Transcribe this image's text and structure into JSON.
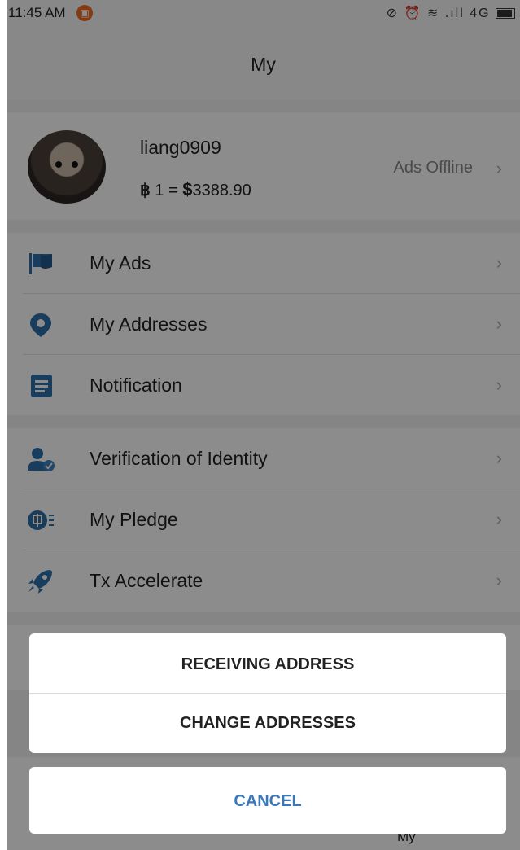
{
  "status_bar": {
    "time": "11:45 AM",
    "network": "4G",
    "signal_icons": "⊘ ⏰ ≋ .ıll"
  },
  "header": {
    "title": "My"
  },
  "profile": {
    "username": "liang0909",
    "rate_currency": "฿",
    "rate_prefix": "1 =",
    "rate_dollar": "$",
    "rate_value": "3388.90",
    "ads_status": "Ads Offline"
  },
  "menu_group_1": [
    {
      "label": "My Ads",
      "icon": "flag-icon"
    },
    {
      "label": "My Addresses",
      "icon": "location-pin-icon"
    },
    {
      "label": "Notification",
      "icon": "document-icon"
    }
  ],
  "menu_group_2": [
    {
      "label": "Verification of Identity",
      "icon": "verified-user-icon"
    },
    {
      "label": "My Pledge",
      "icon": "pledge-icon"
    },
    {
      "label": "Tx Accelerate",
      "icon": "rocket-icon"
    }
  ],
  "bottom_nav": {
    "my_label": "My"
  },
  "action_sheet": {
    "options": [
      "RECEIVING ADDRESS",
      "CHANGE ADDRESSES"
    ],
    "cancel_label": "CANCEL"
  },
  "colors": {
    "icon_blue": "#2f6fa8",
    "cancel_blue": "#3a78b7",
    "notif_orange": "#f26b21"
  }
}
